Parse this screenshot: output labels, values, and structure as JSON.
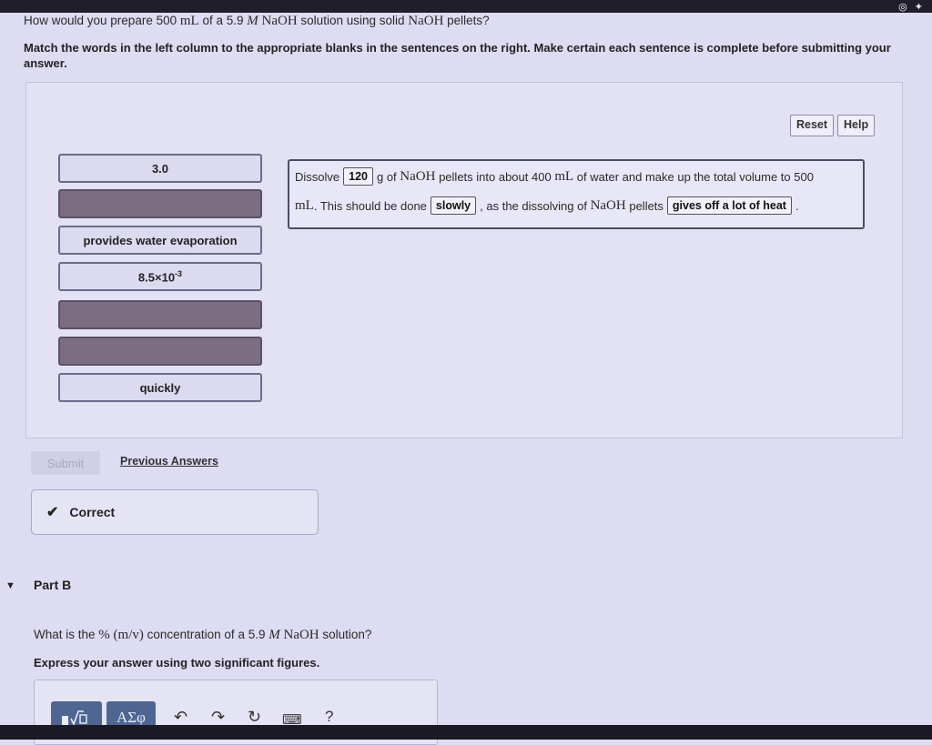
{
  "question": {
    "before": "How would you prepare 500 ",
    "unit_ml": "mL",
    "mid": " of a 5.9 ",
    "unit_m": "M",
    "naoh": "NaOH",
    "after": " solution using solid ",
    "naoh2": "NaOH",
    "end": " pellets?"
  },
  "instructions": "Match the words in the left column to the appropriate blanks in the sentences on the right. Make certain each sentence is complete before submitting your answer.",
  "buttons": {
    "reset": "Reset",
    "help": "Help"
  },
  "tiles": [
    {
      "label": "3.0"
    },
    {
      "label": ""
    },
    {
      "label": "provides water evaporation"
    },
    {
      "label_base": "8.5×10",
      "label_exp": "-3"
    },
    {
      "label": ""
    },
    {
      "label": ""
    },
    {
      "label": "quickly"
    }
  ],
  "sentence": {
    "l1_a": "Dissolve",
    "blank1": "120",
    "l1_b": "g of",
    "l1_naoh": "NaOH",
    "l1_c": "pellets into about 400",
    "l1_ml": "mL",
    "l1_d": "of water and make up the total volume to 500",
    "l2_ml": "mL",
    "l2_a": ". This should be done",
    "blank2": "slowly",
    "l2_b": ", as the dissolving of",
    "l2_naoh": "NaOH",
    "l2_c": "pellets",
    "blank3": "gives off a lot of heat",
    "l2_end": "."
  },
  "submit": "Submit",
  "previous_answers": "Previous Answers",
  "feedback": "Correct",
  "part_b": {
    "title": "Part B",
    "q_a": "What is the ",
    "q_pct": "%",
    "q_mv": "(m/v)",
    "q_b": " concentration of a 5.9 ",
    "q_m": "M",
    "q_naoh": "NaOH",
    "q_c": " solution?",
    "instruction": "Express your answer using two significant figures."
  },
  "toolbar": {
    "symbols_label": "ΑΣφ",
    "help": "?"
  },
  "icons": [
    "search-icon",
    "signal-icon",
    "template-icon",
    "undo-icon",
    "redo-icon",
    "reset-icon",
    "keyboard-icon",
    "help-icon",
    "checkmark-icon",
    "caret-down-icon"
  ]
}
